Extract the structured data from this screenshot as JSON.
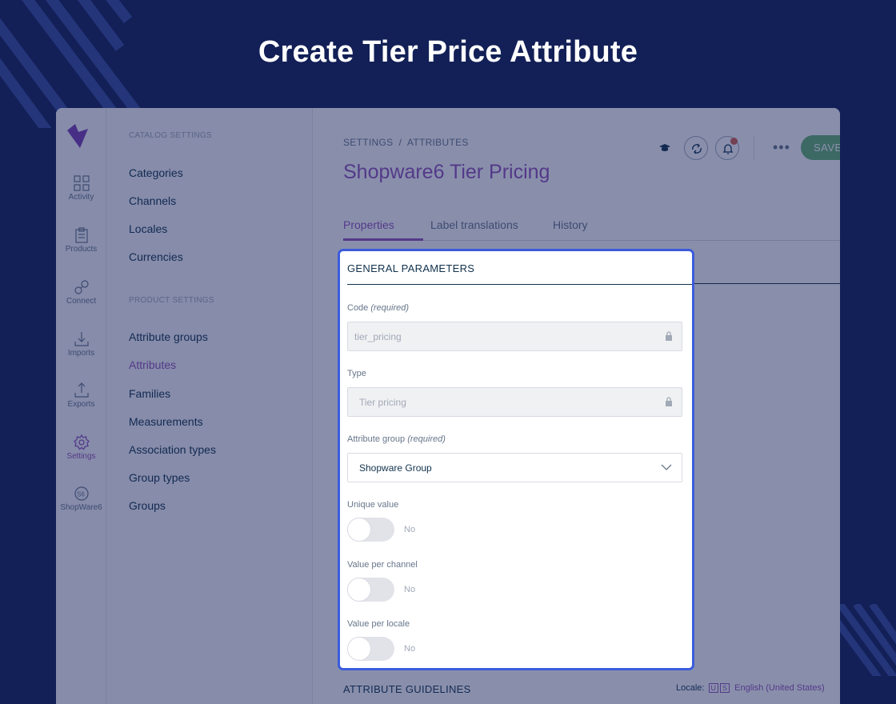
{
  "headline": "Create Tier Price Attribute",
  "colors": {
    "background": "#132057",
    "accent_purple": "#9452ba",
    "save_green": "#67b373",
    "highlight_border": "#3b5bdb",
    "notification_red": "#d4604f"
  },
  "rail": {
    "logo_icon": "akeneo-logo-icon",
    "items": [
      {
        "label": "Activity",
        "icon": "grid-icon"
      },
      {
        "label": "Products",
        "icon": "clipboard-icon"
      },
      {
        "label": "Connect",
        "icon": "connect-icon"
      },
      {
        "label": "Imports",
        "icon": "import-icon"
      },
      {
        "label": "Exports",
        "icon": "export-icon"
      },
      {
        "label": "Settings",
        "icon": "gear-icon"
      },
      {
        "label": "ShopWare6",
        "icon": "shopware-icon"
      }
    ]
  },
  "menu": {
    "catalog_title": "CATALOG SETTINGS",
    "catalog_items": [
      "Categories",
      "Channels",
      "Locales",
      "Currencies"
    ],
    "product_title": "PRODUCT SETTINGS",
    "product_items": [
      "Attribute groups",
      "Attributes",
      "Families",
      "Measurements",
      "Association types",
      "Group types",
      "Groups"
    ]
  },
  "header": {
    "breadcrumb": "SETTINGS  /  ATTRIBUTES",
    "title": "Shopware6 Tier Pricing",
    "save_label": "SAVE",
    "more_label": "•••"
  },
  "tabs": [
    "Properties",
    "Label translations",
    "History"
  ],
  "panel": {
    "title": "GENERAL PARAMETERS",
    "code_label": "Code",
    "code_required": "(required)",
    "code_value": "tier_pricing",
    "type_label": "Type",
    "type_value": "Tier pricing",
    "group_label": "Attribute group",
    "group_required": "(required)",
    "group_value": "Shopware Group",
    "unique_label": "Unique value",
    "unique_value": "No",
    "per_channel_label": "Value per channel",
    "per_channel_value": "No",
    "per_locale_label": "Value per locale",
    "per_locale_value": "No"
  },
  "footer": {
    "guidelines": "ATTRIBUTE GUIDELINES",
    "locale_label": "Locale:",
    "locale_flag_1": "U",
    "locale_flag_2": "S",
    "locale_value": "English (United States)"
  }
}
